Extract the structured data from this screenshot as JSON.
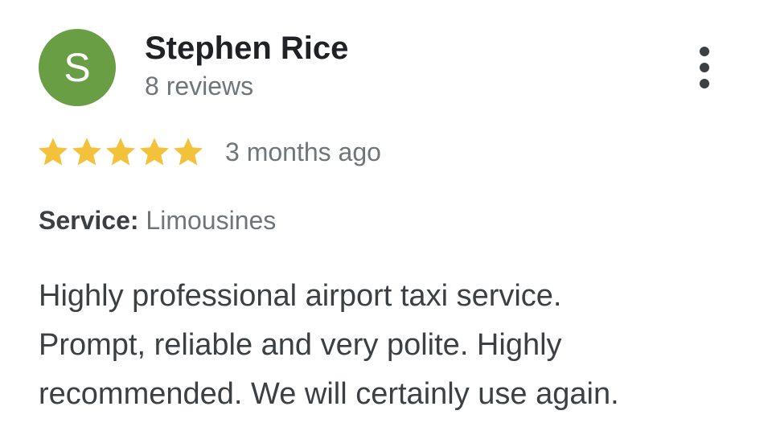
{
  "reviewer": {
    "initial": "S",
    "name": "Stephen Rice",
    "review_count": "8 reviews",
    "avatar_color": "#6a9e45"
  },
  "more_menu": {
    "icon": "more-vert-icon"
  },
  "rating": {
    "stars": 5,
    "max": 5,
    "star_color": "#f4c13a",
    "time": "3 months ago"
  },
  "service": {
    "label": "Service:",
    "value": "Limousines"
  },
  "review": {
    "lines": [
      "Highly professional airport taxi service.",
      "Prompt, reliable and very polite. Highly",
      "recommended. We will certainly use again."
    ]
  }
}
